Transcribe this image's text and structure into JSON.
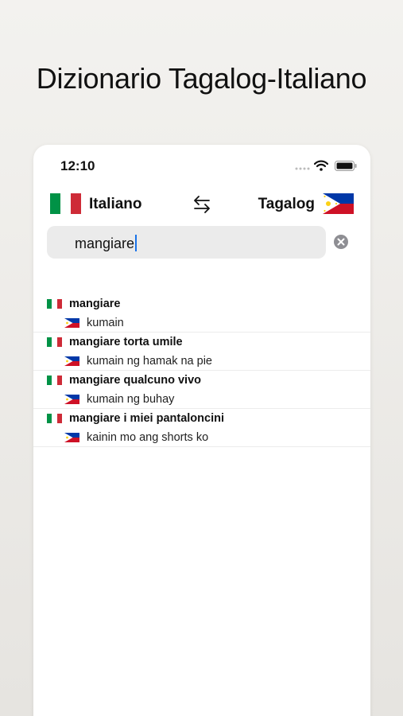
{
  "headline": "Dizionario Tagalog-Italiano",
  "status_bar": {
    "time": "12:10"
  },
  "languages": {
    "source": "Italiano",
    "target": "Tagalog"
  },
  "search": {
    "value": "mangiare"
  },
  "results": [
    {
      "italian": "mangiare",
      "tagalog": "kumain"
    },
    {
      "italian": "mangiare torta umile",
      "tagalog": "kumain ng hamak na pie"
    },
    {
      "italian": "mangiare qualcuno vivo",
      "tagalog": "kumain ng buhay"
    },
    {
      "italian": "mangiare i miei pantaloncini",
      "tagalog": "kainin mo ang shorts ko"
    }
  ],
  "colors": {
    "it_green": "#009246",
    "it_white": "#ffffff",
    "it_red": "#ce2b37",
    "ph_blue": "#0038a8",
    "ph_red": "#ce1126",
    "ph_sun": "#fcd116",
    "caret": "#1a73e8"
  },
  "icons": [
    "signal-icon",
    "wifi-icon",
    "battery-icon",
    "swap-arrows-icon",
    "clear-icon",
    "flag-italy-icon",
    "flag-philippines-icon"
  ]
}
